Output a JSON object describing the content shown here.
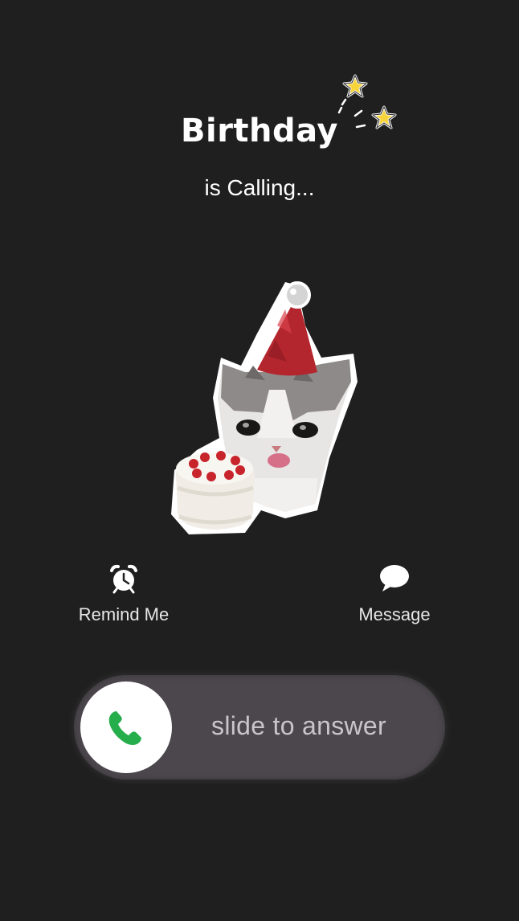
{
  "call": {
    "caller_name": "Birthday",
    "status_text": "is Calling...",
    "avatar_icon": "party-cat-with-cake-sticker"
  },
  "actions": {
    "remind": {
      "label": "Remind Me",
      "icon": "alarm-clock-icon"
    },
    "message": {
      "label": "Message",
      "icon": "speech-bubble-icon"
    }
  },
  "slider": {
    "label": "slide to answer",
    "icon": "phone-icon",
    "knob_color": "#ffffff",
    "phone_color": "#27ae4c"
  },
  "colors": {
    "background": "#1f1f1f",
    "track": "#4b474d"
  }
}
